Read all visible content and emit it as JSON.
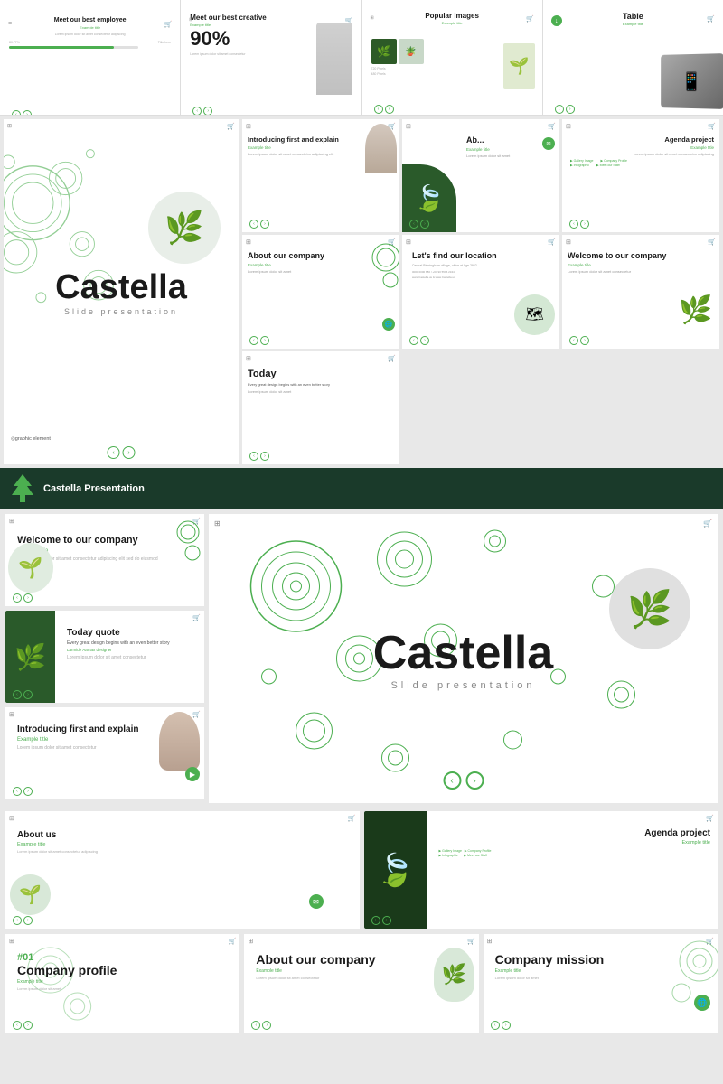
{
  "app": {
    "name": "Castella Presentation",
    "subtitle": "Slide presentation"
  },
  "top_row": {
    "thumbs": [
      {
        "title": "Meet our best employee",
        "label": "Example title",
        "percent": "80.77%",
        "type": "employee"
      },
      {
        "title": "Meet our best creative",
        "label": "Example title",
        "big_number": "90%",
        "type": "creative"
      },
      {
        "title": "Popular images",
        "label": "Example title",
        "type": "images"
      },
      {
        "title": "Table",
        "label": "Example title",
        "type": "table"
      }
    ]
  },
  "middle_row": {
    "left": {
      "title": "Castella",
      "subtitle": "Slide presentation"
    },
    "right_slides": [
      {
        "title": "Introducing first and explain",
        "label": "Example title",
        "text": "Lorem ipsum dolor sit amet consectetur adipiscing elit",
        "type": "intro"
      },
      {
        "title": "Ab...",
        "label": "Example title",
        "text": "Lorem ipsum dolor sit amet",
        "type": "about"
      },
      {
        "title": "Agenda project",
        "label": "Example title",
        "text": "Lorem ipsum dolor sit amet consectetur adipiscing",
        "items": [
          "Gallery Image",
          "Company Profile",
          "Infographic",
          "Meet our Staff"
        ],
        "type": "agenda"
      },
      {
        "title": "About our company",
        "label": "Example title",
        "text": "Lorem ipsum dolor sit amet",
        "type": "about_company"
      },
      {
        "title": "Let's find our location",
        "label": "Example title",
        "address": "Central Birmingham village, office at Age 2962",
        "phone": "0000 0000 880 / +63 90 5596 2344",
        "web": "www.Castella.us & www.Castella.us",
        "type": "location"
      },
      {
        "title": "Welcome to our company",
        "label": "Example title",
        "text": "Lorem ipsum dolor sit amet consectetur",
        "type": "welcome"
      },
      {
        "title": "Today",
        "label": "Every great design begins with an even better story",
        "type": "today"
      }
    ]
  },
  "bottom_bar": {
    "label": "Castella Presentation"
  },
  "featured": {
    "center": {
      "title": "Castella",
      "subtitle": "Slide presentation"
    },
    "left_slides": [
      {
        "title": "Welcome to our company",
        "label": "Example title",
        "text": "Lorem ipsum dolor sit amet consectetur adipiscing elit sed do eiusmod",
        "type": "welcome"
      },
      {
        "title": "Today quote",
        "label": "Every great design begins with an even better story",
        "author": "Larmide Aamax designer",
        "text": "Lorem ipsum dolor sit amet consectetur",
        "type": "quote"
      },
      {
        "title": "Introducing first and explain",
        "label": "Example title",
        "text": "Lorem ipsum dolor sit amet consectetur",
        "type": "intro"
      }
    ]
  },
  "bottom_slides": [
    {
      "title": "About us",
      "label": "Example title",
      "text": "Lorem ipsum dolor sit amet consectetur adipiscing",
      "type": "about"
    },
    {
      "title": "Agenda project",
      "label": "Example title",
      "items": [
        "Gallery Image",
        "Company Profile",
        "Infographic",
        "Meet our Staff"
      ],
      "type": "agenda"
    }
  ],
  "very_bottom": [
    {
      "title": "#01",
      "subtitle": "Company profile",
      "label": "Example title",
      "text": "Lorem ipsum dolor sit amet",
      "type": "profile"
    },
    {
      "title": "About our company",
      "label": "Example title",
      "text": "Lorem ipsum dolor sit amet consectetur",
      "type": "about"
    },
    {
      "title": "Company mission",
      "label": "Example title",
      "text": "Lorem ipsum dolor sit amet",
      "type": "mission"
    }
  ],
  "icons": {
    "cart": "🛒",
    "grid": "⊞",
    "globe": "🌐",
    "email": "✉",
    "arrow_left": "‹",
    "arrow_right": "›",
    "map_pin": "📍",
    "download": "↓",
    "share": "↗"
  },
  "colors": {
    "green": "#4caf50",
    "dark_green": "#1a3a28",
    "light_green": "#d4e8d4",
    "dark": "#1a1a1a",
    "white": "#ffffff",
    "gray": "#e8e8e8",
    "text_gray": "#aaaaaa"
  }
}
